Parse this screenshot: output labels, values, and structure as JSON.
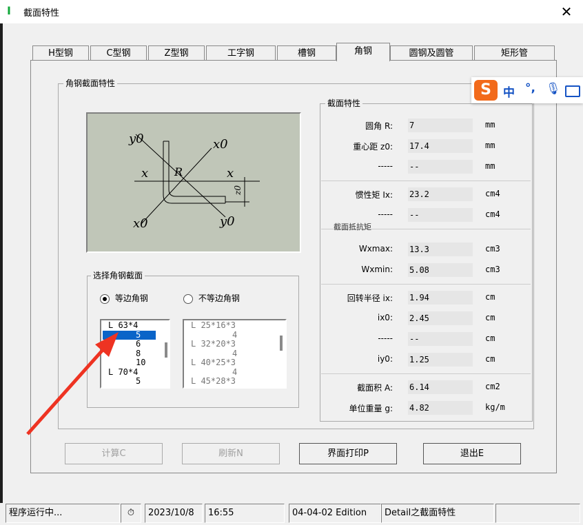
{
  "window": {
    "title": "截面特性"
  },
  "tabs": [
    "H型钢",
    "C型钢",
    "Z型钢",
    "工字钢",
    "槽钢",
    "角钢",
    "圆钢及圆管",
    "矩形管"
  ],
  "active_tab": "角钢",
  "section_group": {
    "title": "角钢截面特性"
  },
  "diagram": {
    "labels": {
      "y0_top": "y0",
      "x0_top": "x0",
      "x_left": "x",
      "R": "R",
      "x_right": "x",
      "z0": "z0",
      "x0_bottom": "x0",
      "y0_bottom": "y0"
    }
  },
  "select_group": {
    "title": "选择角钢截面",
    "radio_equal": "等边角钢",
    "radio_unequal": "不等边角钢",
    "equal_list": [
      "L 63*4",
      "5",
      "6",
      "8",
      "10",
      "L 70*4",
      "5"
    ],
    "selected_index": 1,
    "unequal_list": [
      "L 25*16*3",
      "4",
      "L 32*20*3",
      "4",
      "L 40*25*3",
      "4",
      "L 45*28*3"
    ]
  },
  "props": {
    "title": "截面特性",
    "rows": [
      {
        "label": "圆角    R:",
        "value": "7",
        "unit": "mm"
      },
      {
        "label": "重心距 z0:",
        "value": "17.4",
        "unit": "mm"
      },
      {
        "label": "-----",
        "value": "--",
        "unit": "mm"
      },
      {
        "label": "惯性矩 Ix:",
        "value": "23.2",
        "unit": "cm4"
      },
      {
        "label": "-----",
        "value": "--",
        "unit": "cm4"
      },
      {
        "label": "Wxmax:",
        "value": "13.3",
        "unit": "cm3"
      },
      {
        "label": "Wxmin:",
        "value": "5.08",
        "unit": "cm3"
      },
      {
        "label": "回转半径  ix:",
        "value": "1.94",
        "unit": "cm"
      },
      {
        "label": "ix0:",
        "value": "2.45",
        "unit": "cm"
      },
      {
        "label": "-----",
        "value": "--",
        "unit": "cm"
      },
      {
        "label": "iy0:",
        "value": "1.25",
        "unit": "cm"
      },
      {
        "label": "截面积  A:",
        "value": "6.14",
        "unit": "cm2"
      },
      {
        "label": "单位重量  g:",
        "value": "4.82",
        "unit": "kg/m"
      }
    ],
    "section_modulus_label": "截面抵抗矩"
  },
  "buttons": {
    "calc": "计算C",
    "refresh": "刷新N",
    "print": "界面打印P",
    "exit": "退出E"
  },
  "status": {
    "running": "程序运行中...",
    "date": "2023/10/8",
    "time": "16:55",
    "edition": "04-04-02 Edition",
    "detail": "Detail之截面特性"
  },
  "ime": {
    "mode": "中"
  }
}
